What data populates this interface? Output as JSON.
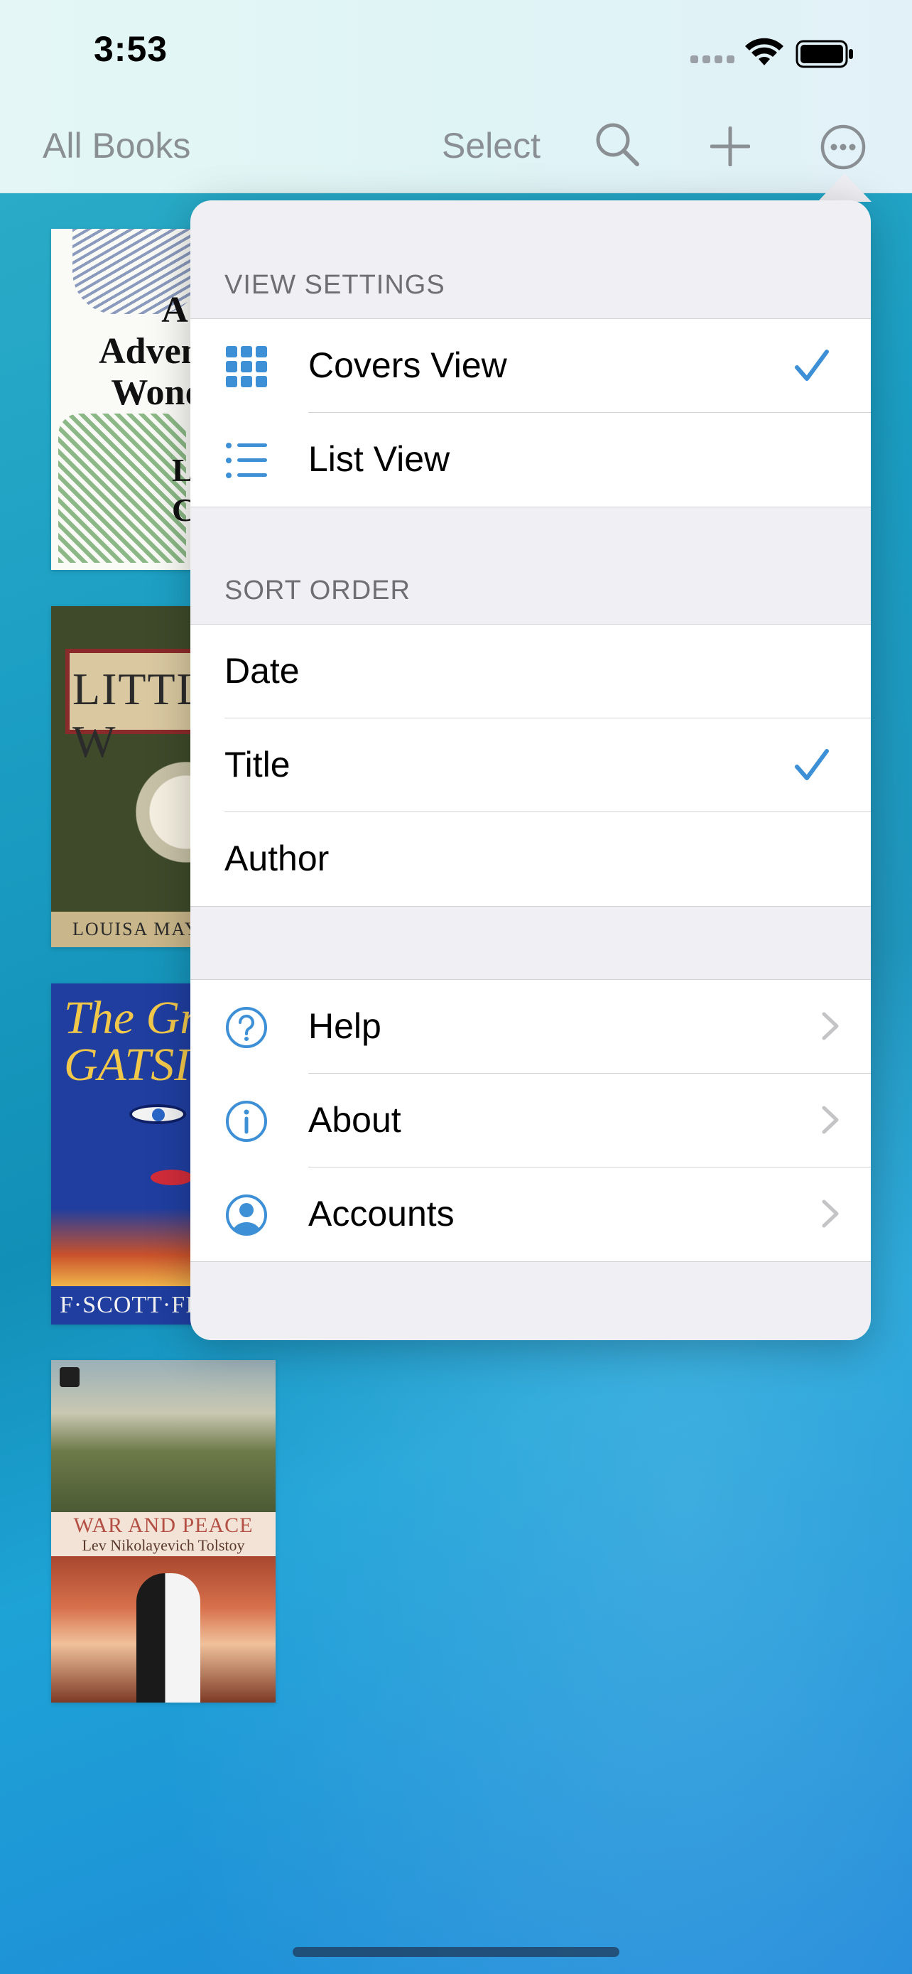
{
  "status_bar": {
    "time": "3:53"
  },
  "nav": {
    "all_books": "All Books",
    "select": "Select",
    "icons": [
      "search-icon",
      "plus-icon",
      "more-icon"
    ]
  },
  "books": [
    {
      "cover_title_lines": [
        "A",
        "Adventur",
        "Wonder"
      ],
      "cover_author_lines": [
        "L",
        "Ca"
      ]
    },
    {
      "cover_title": "LITTLE W",
      "cover_author": "LOUISA MAY A"
    },
    {
      "cover_title_lines": [
        "The Gr",
        "GATSI"
      ],
      "cover_author": "F·SCOTT·FITZ"
    },
    {
      "cover_title": "WAR AND PEACE",
      "cover_author": "Lev Nikolayevich Tolstoy"
    }
  ],
  "menu": {
    "view_settings": {
      "header": "VIEW SETTINGS",
      "items": [
        {
          "label": "Covers View",
          "icon": "grid-icon",
          "checked": true
        },
        {
          "label": "List View",
          "icon": "list-icon",
          "checked": false
        }
      ]
    },
    "sort_order": {
      "header": "SORT ORDER",
      "items": [
        {
          "label": "Date",
          "checked": false
        },
        {
          "label": "Title",
          "checked": true
        },
        {
          "label": "Author",
          "checked": false
        }
      ]
    },
    "more": {
      "items": [
        {
          "label": "Help",
          "icon": "help-icon"
        },
        {
          "label": "About",
          "icon": "info-icon"
        },
        {
          "label": "Accounts",
          "icon": "account-icon"
        }
      ]
    }
  },
  "colors": {
    "accent": "#3d8fd6",
    "nav_text": "#8a8f94"
  }
}
